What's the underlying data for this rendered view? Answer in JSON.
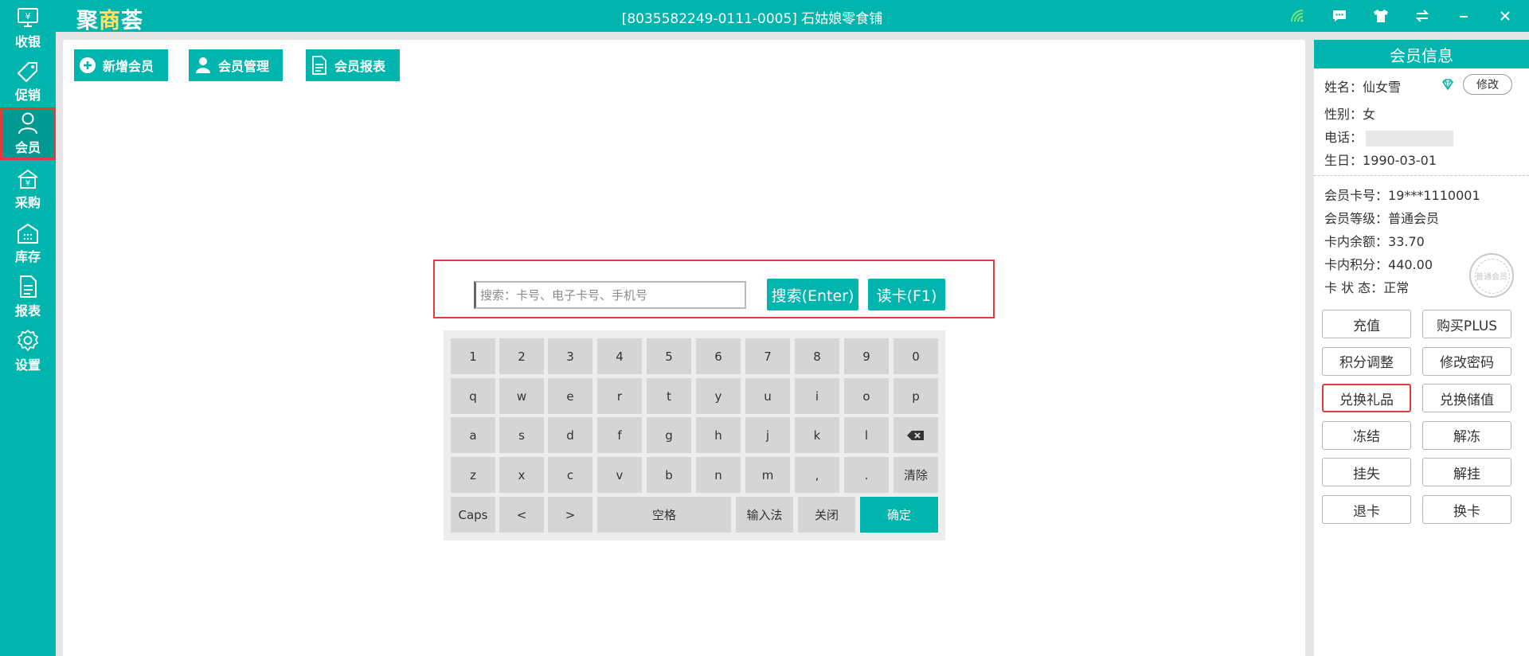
{
  "app": {
    "logo_main": "聚",
    "logo_accent": "商",
    "logo_tail": "荟",
    "store_title": "[8035582249-0111-0005] 石姑娘零食铺"
  },
  "window_icons": [
    "wifi-icon",
    "chat-icon",
    "tshirt-icon",
    "switch-icon",
    "minimize-icon",
    "close-icon"
  ],
  "sidebar": {
    "items": [
      {
        "label": "收银",
        "icon": "cashier-icon"
      },
      {
        "label": "促销",
        "icon": "tag-icon"
      },
      {
        "label": "会员",
        "icon": "user-icon",
        "active": true
      },
      {
        "label": "采购",
        "icon": "purchase-icon"
      },
      {
        "label": "库存",
        "icon": "warehouse-icon"
      },
      {
        "label": "报表",
        "icon": "report-icon"
      },
      {
        "label": "设置",
        "icon": "gear-icon"
      }
    ]
  },
  "toolbar": {
    "add_member": "新增会员",
    "manage_member": "会员管理",
    "member_report": "会员报表"
  },
  "search": {
    "placeholder": "搜索：卡号、电子卡号、手机号",
    "search_label": "搜索(Enter)",
    "read_card_label": "读卡(F1)"
  },
  "keyboard": {
    "row1": [
      "1",
      "2",
      "3",
      "4",
      "5",
      "6",
      "7",
      "8",
      "9",
      "0"
    ],
    "row2": [
      "q",
      "w",
      "e",
      "r",
      "t",
      "y",
      "u",
      "i",
      "o",
      "p"
    ],
    "row3": [
      "a",
      "s",
      "d",
      "f",
      "g",
      "h",
      "j",
      "k",
      "l"
    ],
    "row4": [
      "z",
      "x",
      "c",
      "v",
      "b",
      "n",
      "m",
      ",",
      "."
    ],
    "clear": "清除",
    "caps": "Caps",
    "left": "<",
    "right": ">",
    "space": "空格",
    "ime": "输入法",
    "close": "关闭",
    "confirm": "确定"
  },
  "member": {
    "header": "会员信息",
    "name_label": "姓名：",
    "name": "仙女雪",
    "edit": "修改",
    "gender_label": "性别：",
    "gender": "女",
    "phone_label": "电话：",
    "birthday_label": "生日：",
    "birthday": "1990-03-01",
    "card_no_label": "会员卡号：",
    "card_no": "19***1110001",
    "level_label": "会员等级：",
    "level": "普通会员",
    "balance_label": "卡内余额：",
    "balance": "33.70",
    "points_label": "卡内积分：",
    "points": "440.00",
    "status_label": "卡 状 态：",
    "status": "正常",
    "stamp_text": "普通会员",
    "actions": [
      "充值",
      "购买PLUS",
      "积分调整",
      "修改密码",
      "兑换礼品",
      "兑换储值",
      "冻结",
      "解冻",
      "挂失",
      "解挂",
      "退卡",
      "换卡"
    ]
  }
}
